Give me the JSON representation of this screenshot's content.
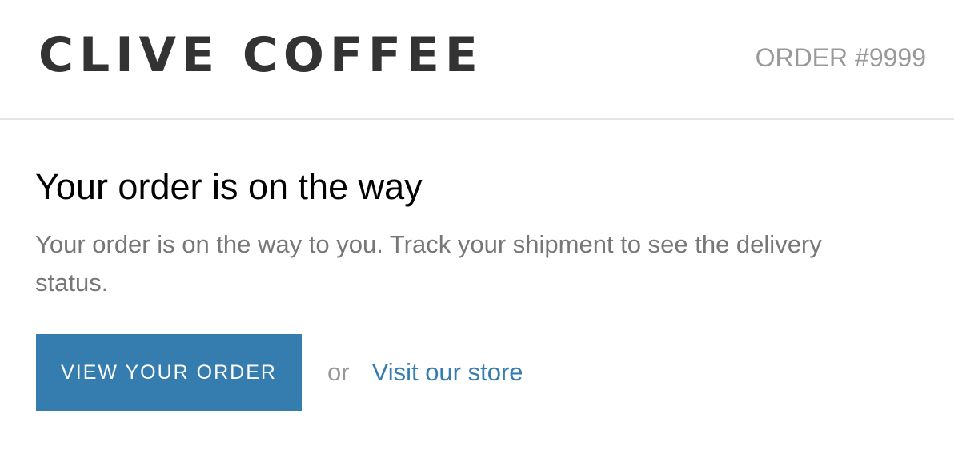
{
  "header": {
    "logo_text": "CLIVE COFFEE",
    "order_number": "ORDER #9999"
  },
  "main": {
    "title": "Your order is on the way",
    "message": "Your order is on the way to you. Track your shipment to see the delivery status.",
    "view_order_label": "VIEW YOUR ORDER",
    "or_label": "or",
    "store_link_label": "Visit our store"
  },
  "colors": {
    "accent": "#357daf",
    "heading": "#000000",
    "muted_text": "#777777",
    "logo": "#333333",
    "divider": "#e5e5e5"
  }
}
